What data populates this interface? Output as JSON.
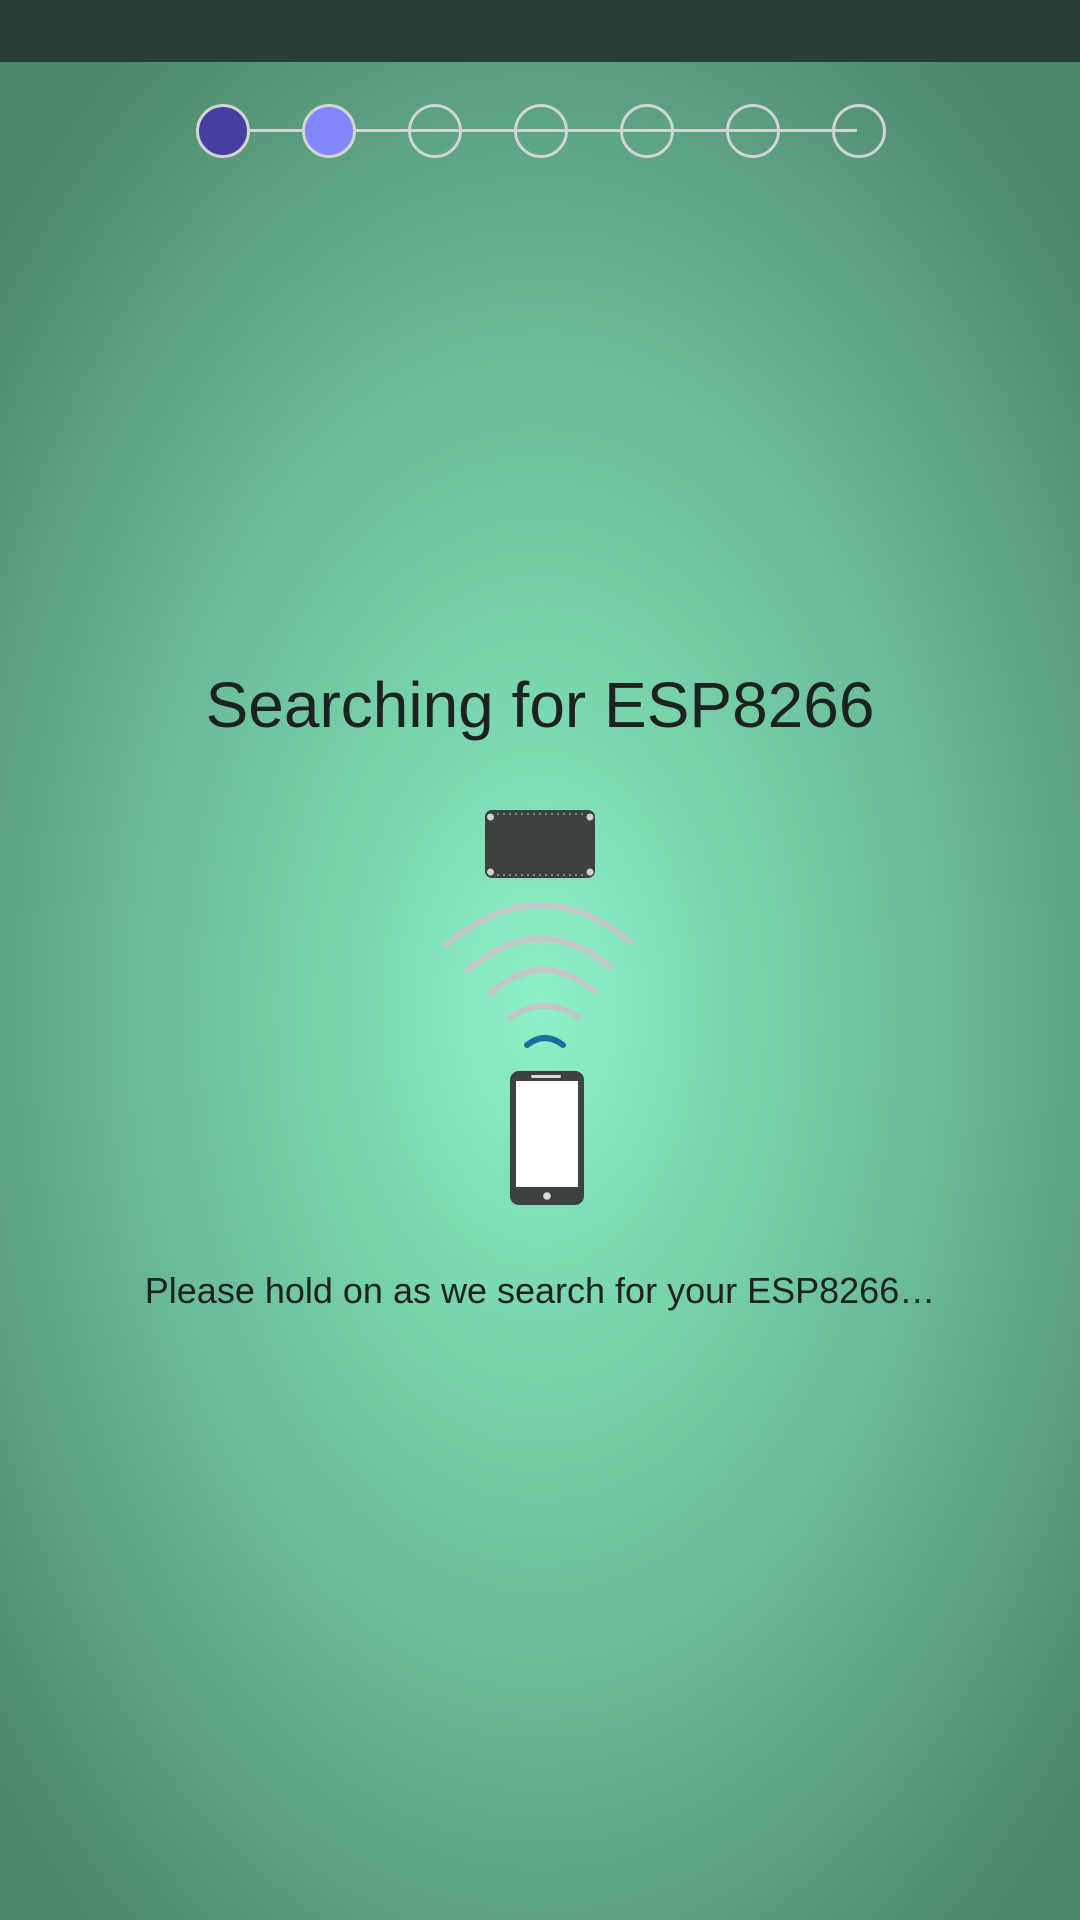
{
  "stepper": {
    "total_steps": 7,
    "completed_steps": 1,
    "current_step": 2
  },
  "screen": {
    "title": "Searching for ESP8266",
    "message": "Please hold on as we search for your ESP8266…"
  },
  "colors": {
    "status_bar": "#253f35",
    "step_done": "#453fa1",
    "step_current": "#8487fc",
    "step_border": "#d3d5d2",
    "signal_active": "#1a6fa0",
    "signal_inactive": "#c3c6c8",
    "device": "#3e4142"
  },
  "illustration": {
    "device_icon": "esp8266-board-icon",
    "signal_icon": "wifi-signal-icon",
    "phone_icon": "smartphone-icon"
  }
}
